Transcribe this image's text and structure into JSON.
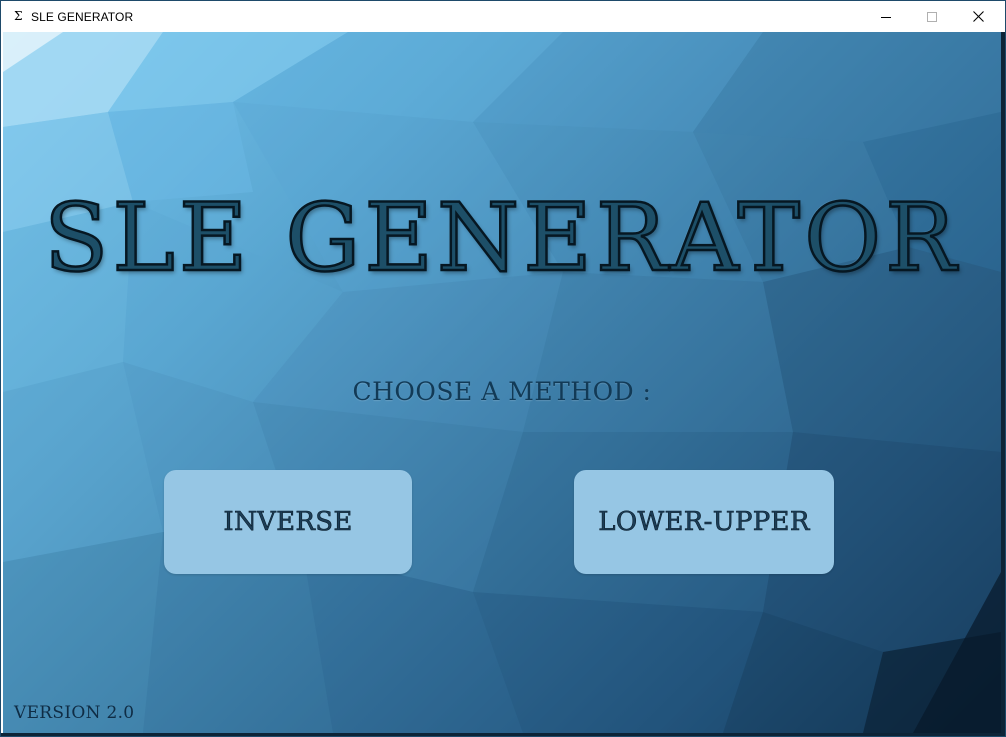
{
  "window": {
    "title": "SLE GENERATOR",
    "app_icon_glyph": "Σ",
    "app_icon": "sigma-icon",
    "controls": {
      "minimize_icon": "minimize-icon",
      "maximize_icon": "maximize-icon",
      "close_icon": "close-icon"
    }
  },
  "main": {
    "headline": "SLE GENERATOR",
    "prompt": "CHOOSE A METHOD :",
    "buttons": {
      "inverse_label": "INVERSE",
      "lower_upper_label": "LOWER-UPPER"
    },
    "version": "VERSION 2.0"
  },
  "colors": {
    "button_bg": "#96c6e4",
    "headline_fill": "#1d4f68",
    "text_dark": "#123a56",
    "background_light": "#78c6ee",
    "background_dark": "#0f2f4d"
  }
}
